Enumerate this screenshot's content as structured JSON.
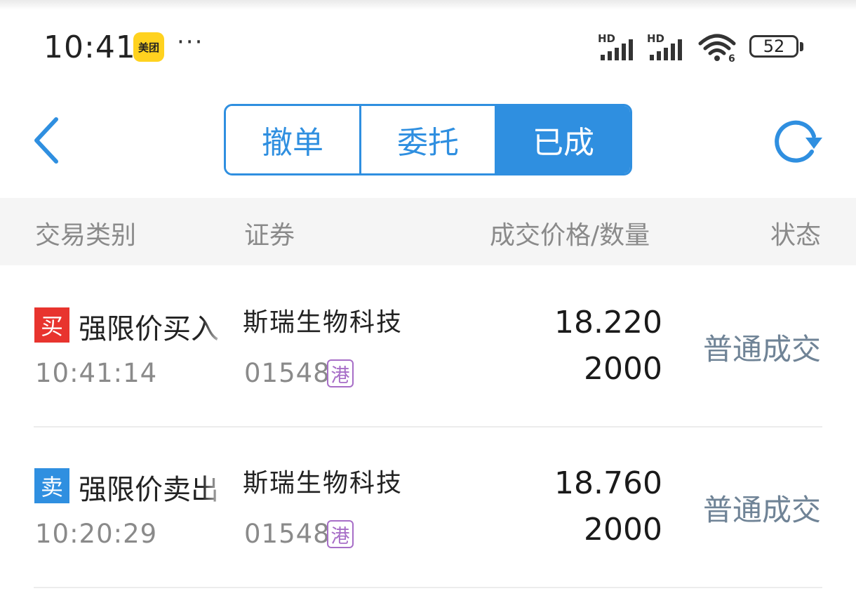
{
  "status_bar": {
    "time": "10:41",
    "app_badge": "美团",
    "more": "···",
    "signal1_label": "HD",
    "signal2_label": "HD",
    "wifi_label": "6",
    "battery": "52"
  },
  "nav": {
    "back_icon": "chevron-left-icon",
    "tabs": [
      {
        "label": "撤单",
        "active": false
      },
      {
        "label": "委托",
        "active": false
      },
      {
        "label": "已成",
        "active": true
      }
    ],
    "refresh_icon": "refresh-icon",
    "accent_color": "#2f8fe0"
  },
  "table": {
    "headers": [
      "交易类别",
      "证券",
      "成交价格/数量",
      "状态"
    ],
    "rows": [
      {
        "side": "买",
        "side_color": "#e8342e",
        "type": "强限价买入",
        "time": "10:41:14",
        "name": "斯瑞生物科技",
        "code": "01548",
        "market": "港",
        "price": "18.220",
        "quantity": "2000",
        "status": "普通成交"
      },
      {
        "side": "卖",
        "side_color": "#2f8fe0",
        "type": "强限价卖出",
        "time": "10:20:29",
        "name": "斯瑞生物科技",
        "code": "01548",
        "market": "港",
        "price": "18.760",
        "quantity": "2000",
        "status": "普通成交"
      }
    ]
  }
}
